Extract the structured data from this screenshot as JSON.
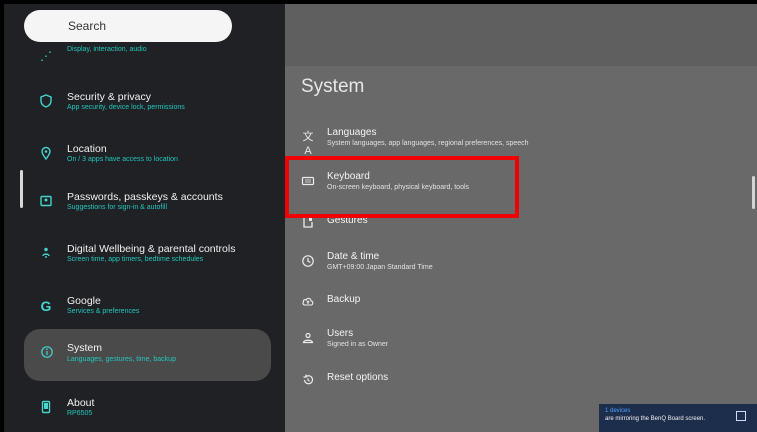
{
  "search": {
    "placeholder": "Search"
  },
  "sidebar": {
    "items": [
      {
        "title": "",
        "subtitle": "Display, interaction, audio",
        "icon": "display-icon"
      },
      {
        "title": "Security & privacy",
        "subtitle": "App security, device lock, permissions",
        "icon": "shield-icon"
      },
      {
        "title": "Location",
        "subtitle": "On / 3 apps have access to location",
        "icon": "location-pin-icon"
      },
      {
        "title": "Passwords, passkeys & accounts",
        "subtitle": "Suggestions for sign-in & autofill",
        "icon": "account-card-icon"
      },
      {
        "title": "Digital Wellbeing & parental controls",
        "subtitle": "Screen time, app timers, bedtime schedules",
        "icon": "wellbeing-icon"
      },
      {
        "title": "Google",
        "subtitle": "Services & preferences",
        "icon": "google-icon"
      },
      {
        "title": "System",
        "subtitle": "Languages, gestures, time, backup",
        "icon": "info-icon",
        "active": true
      },
      {
        "title": "About",
        "subtitle": "RP6505",
        "icon": "device-icon"
      }
    ]
  },
  "main": {
    "title": "System",
    "rows": [
      {
        "title": "Languages",
        "subtitle": "System languages, app languages, regional preferences, speech",
        "icon": "translate-icon"
      },
      {
        "title": "Keyboard",
        "subtitle": "On-screen keyboard, physical keyboard, tools",
        "icon": "keyboard-icon"
      },
      {
        "title": "Gestures",
        "subtitle": "",
        "icon": "gesture-icon"
      },
      {
        "title": "Date & time",
        "subtitle": "GMT+09:00 Japan Standard Time",
        "icon": "clock-icon"
      },
      {
        "title": "Backup",
        "subtitle": "",
        "icon": "backup-icon"
      },
      {
        "title": "Users",
        "subtitle": "Signed in as Owner",
        "icon": "users-icon"
      },
      {
        "title": "Reset options",
        "subtitle": "",
        "icon": "reset-icon"
      }
    ]
  },
  "toast": {
    "line1": "1 devices",
    "line2": "are mirroring the BenQ Board screen.",
    "icon": "cast-icon"
  },
  "colors": {
    "left_bg": "#202124",
    "right_bg": "#696969",
    "accent": "#22c7be",
    "highlight": "#f00202"
  }
}
